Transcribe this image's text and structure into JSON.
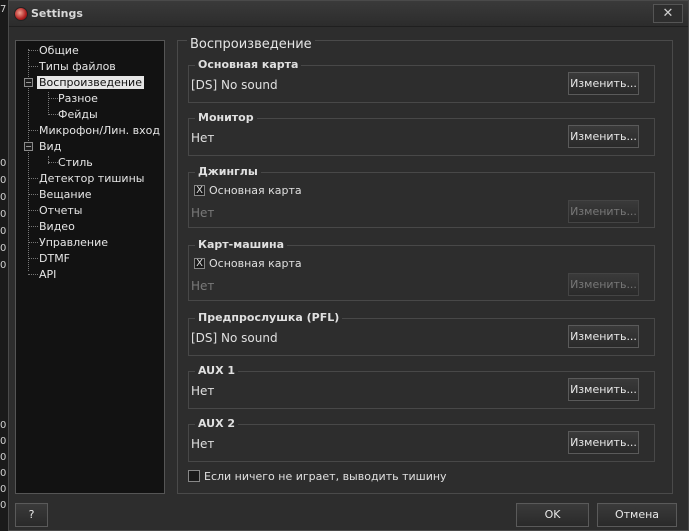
{
  "window": {
    "title": "Settings",
    "close_label": "✕"
  },
  "left_strip": [
    "7",
    "0",
    "0",
    "0",
    "0",
    "0",
    "0",
    "0",
    "0",
    "0",
    "0",
    "0",
    "0",
    "0"
  ],
  "tree": {
    "items": [
      {
        "label": "Общие",
        "level": 0
      },
      {
        "label": "Типы файлов",
        "level": 0
      },
      {
        "label": "Воспроизведение",
        "level": 0,
        "expanded": true,
        "selected": true
      },
      {
        "label": "Разное",
        "level": 1
      },
      {
        "label": "Фейды",
        "level": 1
      },
      {
        "label": "Микрофон/Лин. вход",
        "level": 0
      },
      {
        "label": "Вид",
        "level": 0,
        "expanded": true
      },
      {
        "label": "Стиль",
        "level": 1
      },
      {
        "label": "Детектор тишины",
        "level": 0
      },
      {
        "label": "Вещание",
        "level": 0
      },
      {
        "label": "Отчеты",
        "level": 0
      },
      {
        "label": "Видео",
        "level": 0
      },
      {
        "label": "Управление",
        "level": 0
      },
      {
        "label": "DTMF",
        "level": 0
      },
      {
        "label": "API",
        "level": 0
      }
    ],
    "expander_minus": "−"
  },
  "panel": {
    "title": "Воспроизведение",
    "change_label": "Изменить...",
    "groups": [
      {
        "title": "Основная карта",
        "value": "[DS] No sound"
      },
      {
        "title": "Монитор",
        "value": "Нет"
      },
      {
        "title": "Джинглы",
        "checkbox": "Основная карта",
        "checked_mark": "X",
        "value": "Нет"
      },
      {
        "title": "Карт-машина",
        "checkbox": "Основная карта",
        "checked_mark": "X",
        "value": "Нет"
      },
      {
        "title": "Предпрослушка (PFL)",
        "value": "[DS] No sound"
      },
      {
        "title": "AUX 1",
        "value": "Нет"
      },
      {
        "title": "AUX 2",
        "value": "Нет"
      }
    ],
    "silence_option": "Если ничего не играет, выводить тишину"
  },
  "footer": {
    "help_label": "?",
    "ok_label": "OK",
    "cancel_label": "Отмена"
  }
}
